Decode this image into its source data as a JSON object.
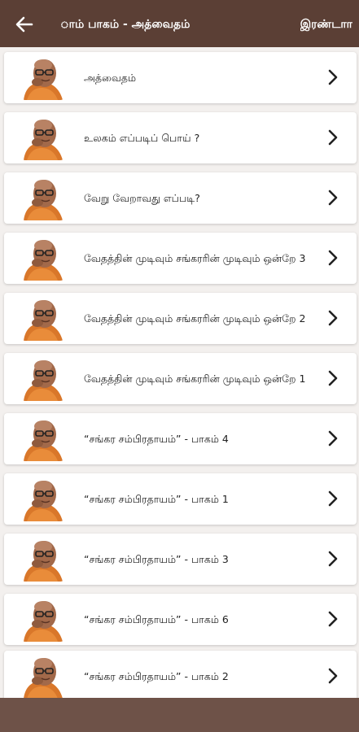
{
  "header": {
    "title": "ாம் பாகம் - அத்வைதம்",
    "right_label": "இரண்டாா"
  },
  "colors": {
    "header_bg": "#5b3f35",
    "list_bg": "#f3f0ee",
    "card_bg": "#ffffff",
    "bottom_bg": "#6e5248"
  },
  "icons": {
    "back": "arrow-left-icon",
    "chevron": "chevron-right-icon",
    "avatar": "portrait-avatar"
  },
  "items": [
    {
      "label": "அத்வைதம்"
    },
    {
      "label": "உலகம் எப்படிப் பொய் ?"
    },
    {
      "label": "வேறு வேறாவது எப்படி?"
    },
    {
      "label": "வேதத்தின் முடிவும் சங்கரரின் முடிவும் ஒன்றே 3"
    },
    {
      "label": "வேதத்தின் முடிவும் சங்கரரின் முடிவும் ஒன்றே 2"
    },
    {
      "label": "வேதத்தின் முடிவும் சங்கரரின் முடிவும் ஒன்றே 1"
    },
    {
      "label": "“சங்கர சம்பிரதாயம்” - பாகம் 4"
    },
    {
      "label": "“சங்கர சம்பிரதாயம்” - பாகம் 1"
    },
    {
      "label": "“சங்கர சம்பிரதாயம்” - பாகம் 3"
    },
    {
      "label": "“சங்கர சம்பிரதாயம்” - பாகம் 6"
    },
    {
      "label": "“சங்கர சம்பிரதாயம்” - பாகம் 2"
    }
  ]
}
